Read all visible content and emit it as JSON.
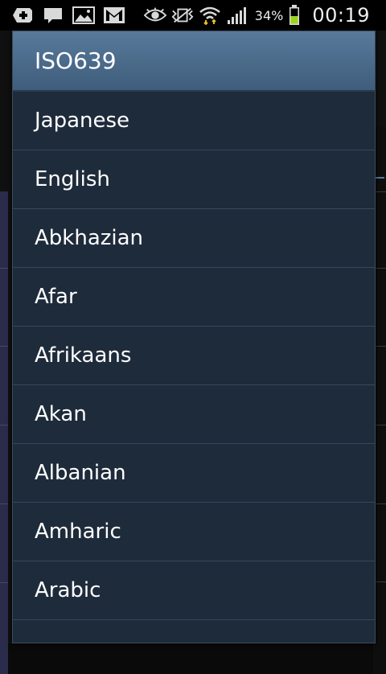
{
  "status_bar": {
    "icons_left": [
      "add-icon",
      "message-icon",
      "image-icon",
      "gmail-icon"
    ],
    "icons_right": [
      "eye-icon",
      "vibrate-icon",
      "wifi-icon",
      "signal-icon",
      "battery-icon"
    ],
    "battery_percent": "34%",
    "time": "00:19"
  },
  "dialog": {
    "title": "ISO639",
    "items": [
      "Japanese",
      "English",
      "Abkhazian",
      "Afar",
      "Afrikaans",
      "Akan",
      "Albanian",
      "Amharic",
      "Arabic"
    ]
  },
  "colors": {
    "dialog_bg": "#1e2b3b",
    "title_bg": "#4b6b8b",
    "divider": "#37485b",
    "battery_green": "#9bd21e"
  }
}
